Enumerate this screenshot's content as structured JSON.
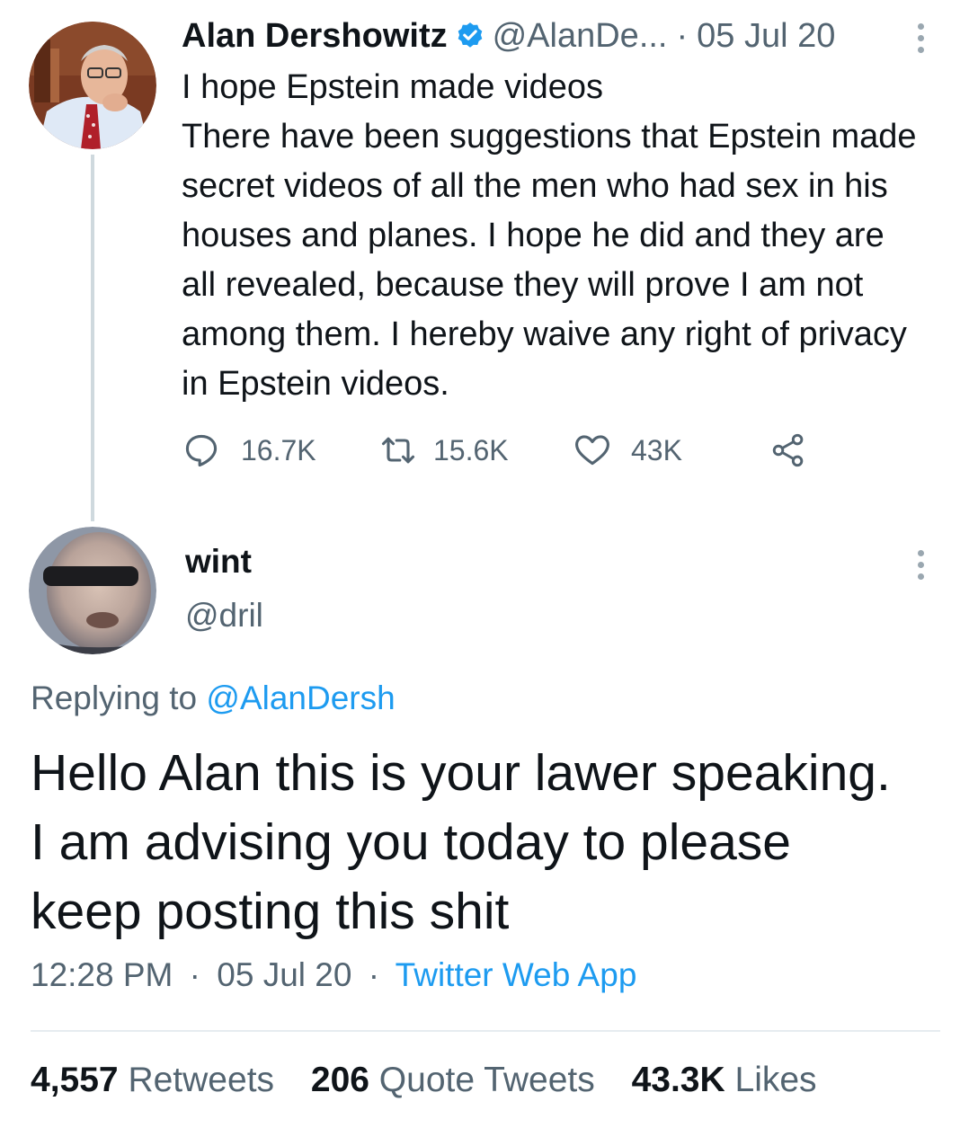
{
  "original_tweet": {
    "author_name": "Alan Dershowitz",
    "handle": "@AlanDe...",
    "separator": "·",
    "date": "05 Jul 20",
    "text": "I hope Epstein made videos\nThere have been suggestions that Epstein made secret videos of all the men who had sex in his houses and planes. I hope he did and they are all revealed, because they will prove I am not among them. I hereby waive any right of privacy in Epstein videos.",
    "replies": "16.7K",
    "retweets": "15.6K",
    "likes": "43K"
  },
  "reply_tweet": {
    "author_name": "wint",
    "handle": "@dril",
    "replying_prefix": "Replying to",
    "replying_to": "@AlanDersh",
    "text": "Hello Alan this is your lawer speaking.\nI am advising you today to please\nkeep posting this shit",
    "time": "12:28 PM",
    "separator": "·",
    "date": "05 Jul 20",
    "source": "Twitter Web App",
    "stats": {
      "retweets_count": "4,557",
      "retweets_label": "Retweets",
      "quotes_count": "206",
      "quotes_label": "Quote Tweets",
      "likes_count": "43.3K",
      "likes_label": "Likes"
    }
  },
  "colors": {
    "text": "#0f1419",
    "muted": "#536471",
    "link": "#1d9bf0",
    "thread_line": "#cfd9de",
    "verified": "#1d9bf0"
  },
  "icons": [
    "verified-badge-icon",
    "more-options-icon",
    "reply-icon",
    "retweet-icon",
    "like-icon",
    "share-icon"
  ]
}
